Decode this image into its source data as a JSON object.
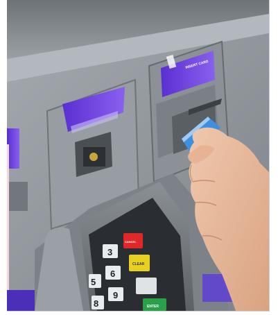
{
  "scene": {
    "subject": "atm-card-insertion",
    "slot_label": "INSERT CARD",
    "keypad": {
      "visible_digits": [
        "3",
        "6",
        "9",
        "5",
        "8"
      ],
      "function_keys": [
        "CANCEL",
        "CLEAR",
        "ENTER"
      ]
    }
  },
  "colors": {
    "panel": "#8e9499",
    "panel_dark": "#5f6469",
    "accent_purple": "#6c3fe0",
    "card_blue": "#3d8fe0",
    "key_red": "#e02828",
    "key_yellow": "#e8d020",
    "key_green": "#2aa04a",
    "skin": "#e8b89a"
  }
}
